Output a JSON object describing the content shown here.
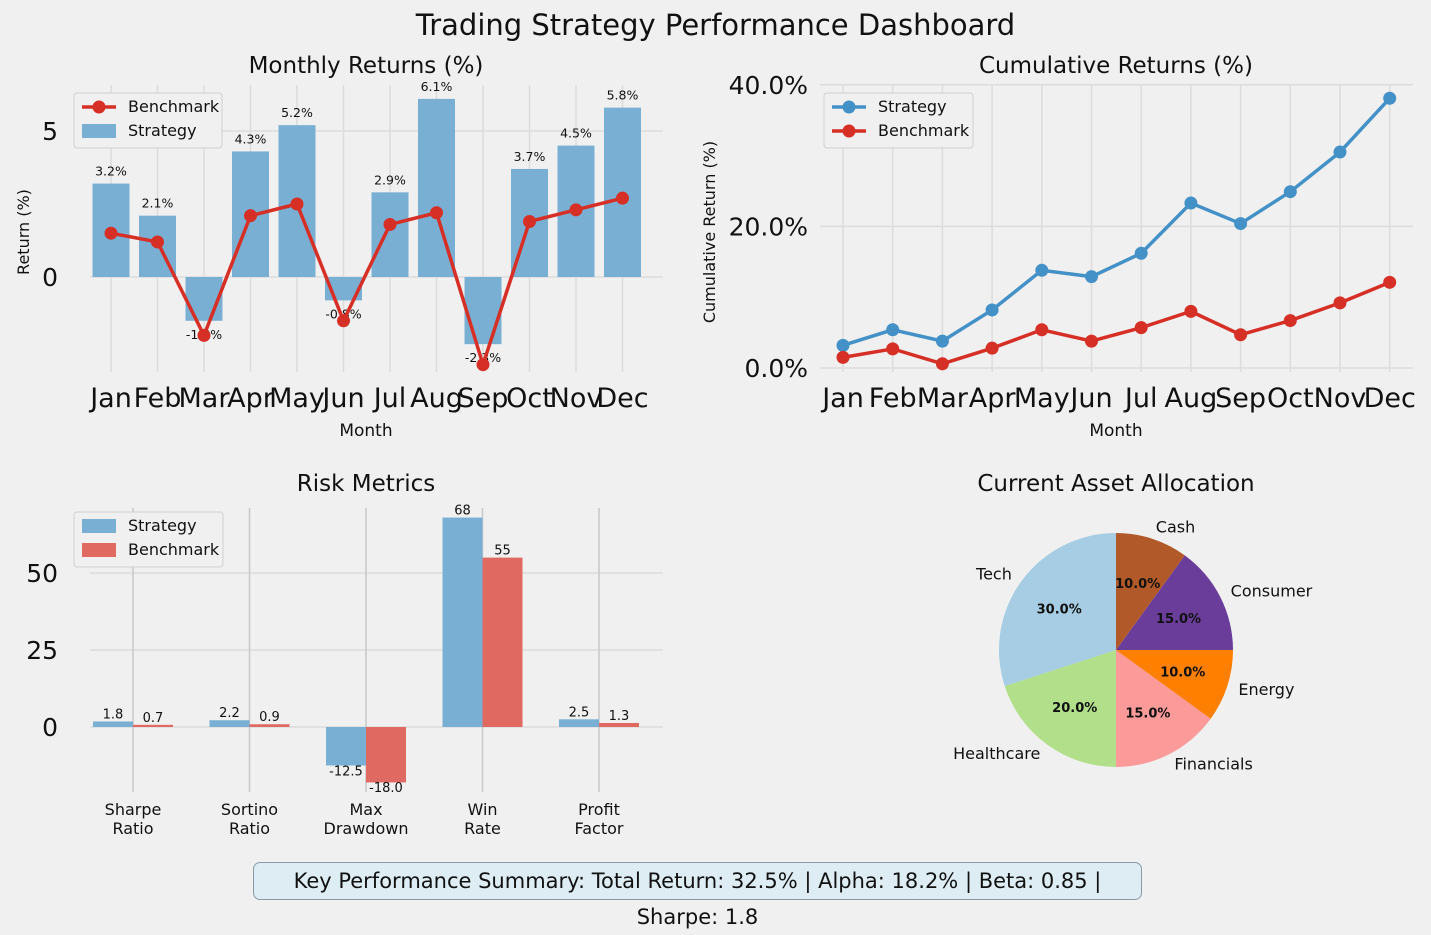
{
  "page": {
    "title": "Trading Strategy Performance Dashboard",
    "summary": "Key Performance Summary: Total Return: 32.5% | Alpha: 18.2% | Beta: 0.85 | Sharpe: 1.8"
  },
  "colors": {
    "strategy": "#7aafd4",
    "benchmark": "#d62f26",
    "strategy_line": "#4491c7",
    "benchmark_bar": "#e06a62",
    "background": "#f0f0f0",
    "grid": "#dcdcdc"
  },
  "chart_data": [
    {
      "id": "monthly",
      "type": "bar",
      "title": "Monthly Returns (%)",
      "xlabel": "Month",
      "ylabel": "Return (%)",
      "categories": [
        "Jan",
        "Feb",
        "Mar",
        "Apr",
        "May",
        "Jun",
        "Jul",
        "Aug",
        "Sep",
        "Oct",
        "Nov",
        "Dec"
      ],
      "ylim": [
        -3.2,
        6.6
      ],
      "yticks": [
        0,
        5
      ],
      "ytick_labels": [
        "0",
        "5"
      ],
      "legend": {
        "position": "top-left",
        "entries": [
          "Benchmark",
          "Strategy"
        ]
      },
      "series": [
        {
          "name": "Strategy",
          "kind": "bar",
          "values": [
            3.2,
            2.1,
            -1.5,
            4.3,
            5.2,
            -0.8,
            2.9,
            6.1,
            -2.3,
            3.7,
            4.5,
            5.8
          ],
          "labels": [
            "3.2%",
            "2.1%",
            "-1.5%",
            "4.3%",
            "5.2%",
            "-0.8%",
            "2.9%",
            "6.1%",
            "-2.3%",
            "3.7%",
            "4.5%",
            "5.8%"
          ]
        },
        {
          "name": "Benchmark",
          "kind": "line",
          "values": [
            1.5,
            1.2,
            -2.0,
            2.1,
            2.5,
            -1.5,
            1.8,
            2.2,
            -3.0,
            1.9,
            2.3,
            2.7
          ]
        }
      ]
    },
    {
      "id": "cumulative",
      "type": "line",
      "title": "Cumulative Returns (%)",
      "xlabel": "Month",
      "ylabel": "Cumulative Return (%)",
      "categories": [
        "Jan",
        "Feb",
        "Mar",
        "Apr",
        "May",
        "Jun",
        "Jul",
        "Aug",
        "Sep",
        "Oct",
        "Nov",
        "Dec"
      ],
      "ylim": [
        0,
        40
      ],
      "yticks": [
        0,
        20,
        40
      ],
      "ytick_labels": [
        "0.0%",
        "20.0%",
        "40.0%"
      ],
      "legend": {
        "position": "top-left",
        "entries": [
          "Strategy",
          "Benchmark"
        ]
      },
      "series": [
        {
          "name": "Strategy",
          "values": [
            3.2,
            5.4,
            3.8,
            8.2,
            13.8,
            12.9,
            16.2,
            23.3,
            20.4,
            24.9,
            30.5,
            38.1
          ]
        },
        {
          "name": "Benchmark",
          "values": [
            1.5,
            2.7,
            0.6,
            2.8,
            5.4,
            3.8,
            5.7,
            8.0,
            4.7,
            6.7,
            9.2,
            12.1
          ]
        }
      ]
    },
    {
      "id": "risk",
      "type": "bar",
      "title": "Risk Metrics",
      "categories": [
        "Sharpe Ratio",
        "Sortino Ratio",
        "Max Drawdown",
        "Win Rate",
        "Profit Factor"
      ],
      "category_lines": [
        [
          "Sharpe",
          "Ratio"
        ],
        [
          "Sortino",
          "Ratio"
        ],
        [
          "Max",
          "Drawdown"
        ],
        [
          "Win",
          "Rate"
        ],
        [
          "Profit",
          "Factor"
        ]
      ],
      "ylim": [
        -25,
        71
      ],
      "yticks": [
        0,
        25,
        50
      ],
      "ytick_labels": [
        "0",
        "25",
        "50"
      ],
      "legend": {
        "position": "top-left",
        "entries": [
          "Strategy",
          "Benchmark"
        ]
      },
      "series": [
        {
          "name": "Strategy",
          "values": [
            1.8,
            2.2,
            -12.5,
            68,
            2.5
          ],
          "labels": [
            "1.8",
            "2.2",
            "-12.5",
            "68",
            "2.5"
          ]
        },
        {
          "name": "Benchmark",
          "values": [
            0.7,
            0.9,
            -18.0,
            55,
            1.3
          ],
          "labels": [
            "0.7",
            "0.9",
            "-18.0",
            "55",
            "1.3"
          ]
        }
      ]
    },
    {
      "id": "allocation",
      "type": "pie",
      "title": "Current Asset Allocation",
      "slices": [
        {
          "label": "Tech",
          "value": 30.0,
          "pct": "30.0%",
          "color": "#a6cde3"
        },
        {
          "label": "Healthcare",
          "value": 20.0,
          "pct": "20.0%",
          "color": "#b2df8a"
        },
        {
          "label": "Financials",
          "value": 15.0,
          "pct": "15.0%",
          "color": "#fb9a99"
        },
        {
          "label": "Energy",
          "value": 10.0,
          "pct": "10.0%",
          "color": "#ff7f00"
        },
        {
          "label": "Consumer",
          "value": 15.0,
          "pct": "15.0%",
          "color": "#6a3d9a"
        },
        {
          "label": "Cash",
          "value": 10.0,
          "pct": "10.0%",
          "color": "#b15928"
        }
      ]
    }
  ]
}
